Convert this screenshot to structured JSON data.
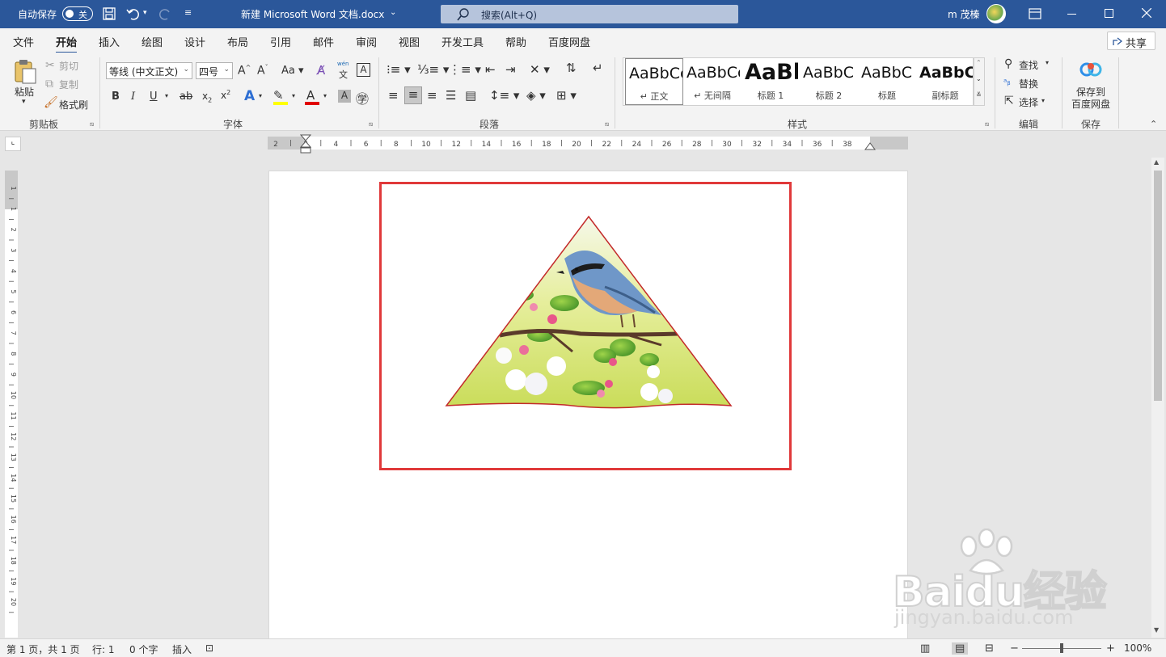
{
  "titlebar": {
    "autosave_label": "自动保存",
    "autosave_state": "关",
    "doc_title": "新建 Microsoft Word 文档.docx",
    "search_placeholder": "搜索(Alt+Q)",
    "user": "m 茂榛",
    "bg_color": "#2b579a"
  },
  "menu": {
    "tabs": [
      "文件",
      "开始",
      "插入",
      "绘图",
      "设计",
      "布局",
      "引用",
      "邮件",
      "审阅",
      "视图",
      "开发工具",
      "帮助",
      "百度网盘"
    ],
    "active": "开始",
    "share_label": "共享"
  },
  "ribbon": {
    "clipboard": {
      "paste": "粘贴",
      "cut": "剪切",
      "copy": "复制",
      "format_painter": "格式刷",
      "label": "剪贴板"
    },
    "font": {
      "font_name": "等线 (中文正文)",
      "font_size": "四号",
      "wen_label": "wén",
      "wen_char": "文",
      "label": "字体"
    },
    "paragraph": {
      "label": "段落"
    },
    "styles": {
      "items": [
        {
          "preview": "AaBbCcI",
          "name": "↵ 正文"
        },
        {
          "preview": "AaBbCcI",
          "name": "↵ 无间隔"
        },
        {
          "preview": "AaBl",
          "name": "标题 1"
        },
        {
          "preview": "AaBbC",
          "name": "标题 2"
        },
        {
          "preview": "AaBbC",
          "name": "标题"
        },
        {
          "preview": "AaBbC",
          "name": "副标题"
        }
      ],
      "label": "样式"
    },
    "editing": {
      "find": "查找",
      "replace": "替换",
      "select": "选择",
      "label": "编辑"
    },
    "save": {
      "line1": "保存到",
      "line2": "百度网盘",
      "label": "保存"
    }
  },
  "ruler": {
    "h_ticks": [
      "2",
      "2",
      "4",
      "6",
      "8",
      "10",
      "12",
      "14",
      "16",
      "18",
      "20",
      "22",
      "24",
      "26",
      "28",
      "30",
      "32",
      "34",
      "36",
      "38"
    ],
    "v_ticks": [
      "1",
      "1",
      "2",
      "3",
      "4",
      "5",
      "6",
      "7",
      "8",
      "9",
      "10",
      "11",
      "12",
      "13",
      "14",
      "15",
      "16",
      "17",
      "18",
      "19",
      "20"
    ]
  },
  "document": {
    "image_shape": "triangle",
    "image_subject": "bird-on-blossom-branch",
    "frame_color": "#e0393a"
  },
  "statusbar": {
    "page": "第 1 页，共 1 页",
    "line": "行: 1",
    "words": "0 个字",
    "mode": "插入",
    "zoom": "100%"
  },
  "watermark": {
    "logo": "Baidu经验",
    "url": "jingyan.baidu.com"
  }
}
